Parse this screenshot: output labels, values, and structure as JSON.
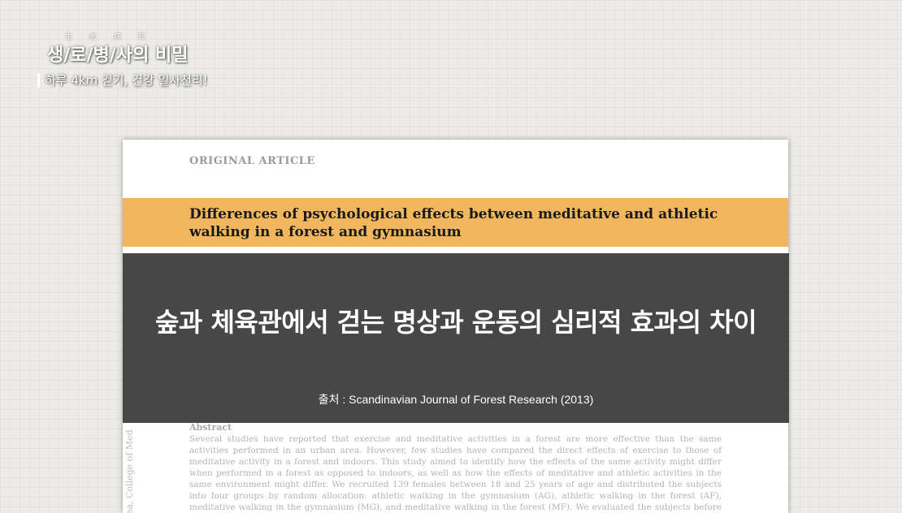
{
  "logo": {
    "small_text": "生 老 病 死",
    "title": "생/로/병/사의 비밀",
    "subtitle": "하루 4km 걷기, 건강 일사천리!"
  },
  "paper": {
    "label": "ORIGINAL ARTICLE",
    "title": "Differences of psychological effects between meditative and athletic walking in a forest and gymnasium",
    "side_text": "ea, College of Med",
    "abstract_heading": "Abstract",
    "abstract_body": "Several studies have reported that exercise and meditative activities in a forest are more effective than the same activities performed in an urban area. However, few studies have compared the direct effects of exercise to those of meditative activity in a forest and indoors. This study aimed to identify how the effects of the same activity might differ when performed in a forest as opposed to indoors, as well as how the effects of meditative and athletic activities in the same environment might differ. We recruited 139 females between 18 and 25 years of age and distributed the subjects into four groups by random allocation: athletic walking in the gymnasium (AG), athletic walking in the forest (AF), meditative walking in the gymnasium (MG), and meditative walking in the forest (MF). We evaluated the subjects before and after walking, using the"
  },
  "overlay": {
    "title": "숲과 체육관에서 걷는 명상과 운동의 심리적 효과의 차이",
    "source": "출처 : Scandinavian Journal of Forest Research (2013)"
  },
  "colors": {
    "background": "#ecebe7",
    "title_band": "#f2b65c",
    "overlay": "#414141"
  }
}
